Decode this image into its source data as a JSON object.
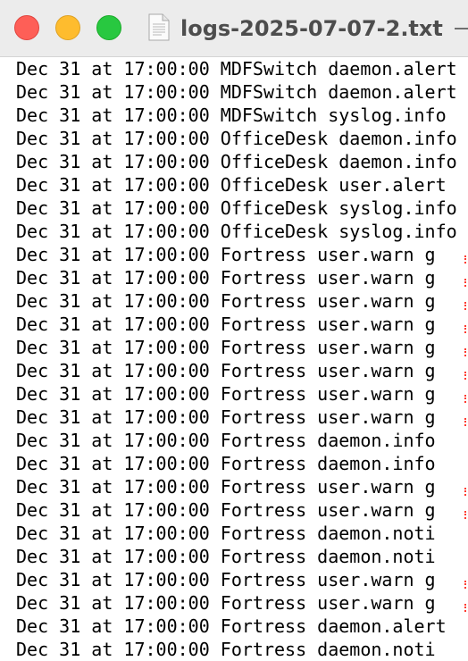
{
  "window": {
    "title": "logs-2025-07-07-2.txt"
  },
  "log_lines": [
    {
      "text": "Dec 31 at 17:00:00 MDFSwitch daemon.alert",
      "spell_mark": false
    },
    {
      "text": "Dec 31 at 17:00:00 MDFSwitch daemon.alert",
      "spell_mark": false
    },
    {
      "text": "Dec 31 at 17:00:00 MDFSwitch syslog.info",
      "spell_mark": false
    },
    {
      "text": "Dec 31 at 17:00:00 OfficeDesk daemon.info",
      "spell_mark": false
    },
    {
      "text": "Dec 31 at 17:00:00 OfficeDesk daemon.info",
      "spell_mark": false
    },
    {
      "text": "Dec 31 at 17:00:00 OfficeDesk user.alert",
      "spell_mark": false
    },
    {
      "text": "Dec 31 at 17:00:00 OfficeDesk syslog.info",
      "spell_mark": false
    },
    {
      "text": "Dec 31 at 17:00:00 OfficeDesk syslog.info",
      "spell_mark": false
    },
    {
      "text": "Dec 31 at 17:00:00 Fortress user.warn g",
      "spell_mark": true
    },
    {
      "text": "Dec 31 at 17:00:00 Fortress user.warn g",
      "spell_mark": true
    },
    {
      "text": "Dec 31 at 17:00:00 Fortress user.warn g",
      "spell_mark": true
    },
    {
      "text": "Dec 31 at 17:00:00 Fortress user.warn g",
      "spell_mark": true
    },
    {
      "text": "Dec 31 at 17:00:00 Fortress user.warn g",
      "spell_mark": true
    },
    {
      "text": "Dec 31 at 17:00:00 Fortress user.warn g",
      "spell_mark": true
    },
    {
      "text": "Dec 31 at 17:00:00 Fortress user.warn g",
      "spell_mark": true
    },
    {
      "text": "Dec 31 at 17:00:00 Fortress user.warn g",
      "spell_mark": true
    },
    {
      "text": "Dec 31 at 17:00:00 Fortress daemon.info",
      "spell_mark": false
    },
    {
      "text": "Dec 31 at 17:00:00 Fortress daemon.info",
      "spell_mark": false
    },
    {
      "text": "Dec 31 at 17:00:00 Fortress user.warn g",
      "spell_mark": true
    },
    {
      "text": "Dec 31 at 17:00:00 Fortress user.warn g",
      "spell_mark": true
    },
    {
      "text": "Dec 31 at 17:00:00 Fortress daemon.noti",
      "spell_mark": false
    },
    {
      "text": "Dec 31 at 17:00:00 Fortress daemon.noti",
      "spell_mark": false
    },
    {
      "text": "Dec 31 at 17:00:00 Fortress user.warn g",
      "spell_mark": true
    },
    {
      "text": "Dec 31 at 17:00:00 Fortress user.warn g",
      "spell_mark": true
    },
    {
      "text": "Dec 31 at 17:00:00 Fortress daemon.alert",
      "spell_mark": false
    },
    {
      "text": "Dec 31 at 17:00:00 Fortress daemon.noti",
      "spell_mark": false
    }
  ],
  "colors": {
    "close": "#fe5f57",
    "minimize": "#febc2e",
    "maximize": "#28c840",
    "titlebar": "#ececec",
    "spell_mark": "#ff3b30"
  },
  "icons": {
    "document": "text-document-icon"
  }
}
